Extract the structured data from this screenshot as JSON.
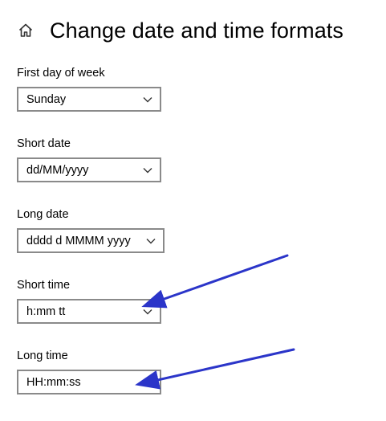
{
  "header": {
    "icon": "home-icon",
    "title": "Change date and time formats"
  },
  "settings": [
    {
      "label": "First day of week",
      "value": "Sunday"
    },
    {
      "label": "Short date",
      "value": "dd/MM/yyyy"
    },
    {
      "label": "Long date",
      "value": "dddd d MMMM yyyy"
    },
    {
      "label": "Short time",
      "value": "h:mm tt"
    },
    {
      "label": "Long time",
      "value": "HH:mm:ss"
    }
  ],
  "colors": {
    "annotation_arrow": "#2b35c9",
    "combo_border": "#8a8a8a"
  }
}
